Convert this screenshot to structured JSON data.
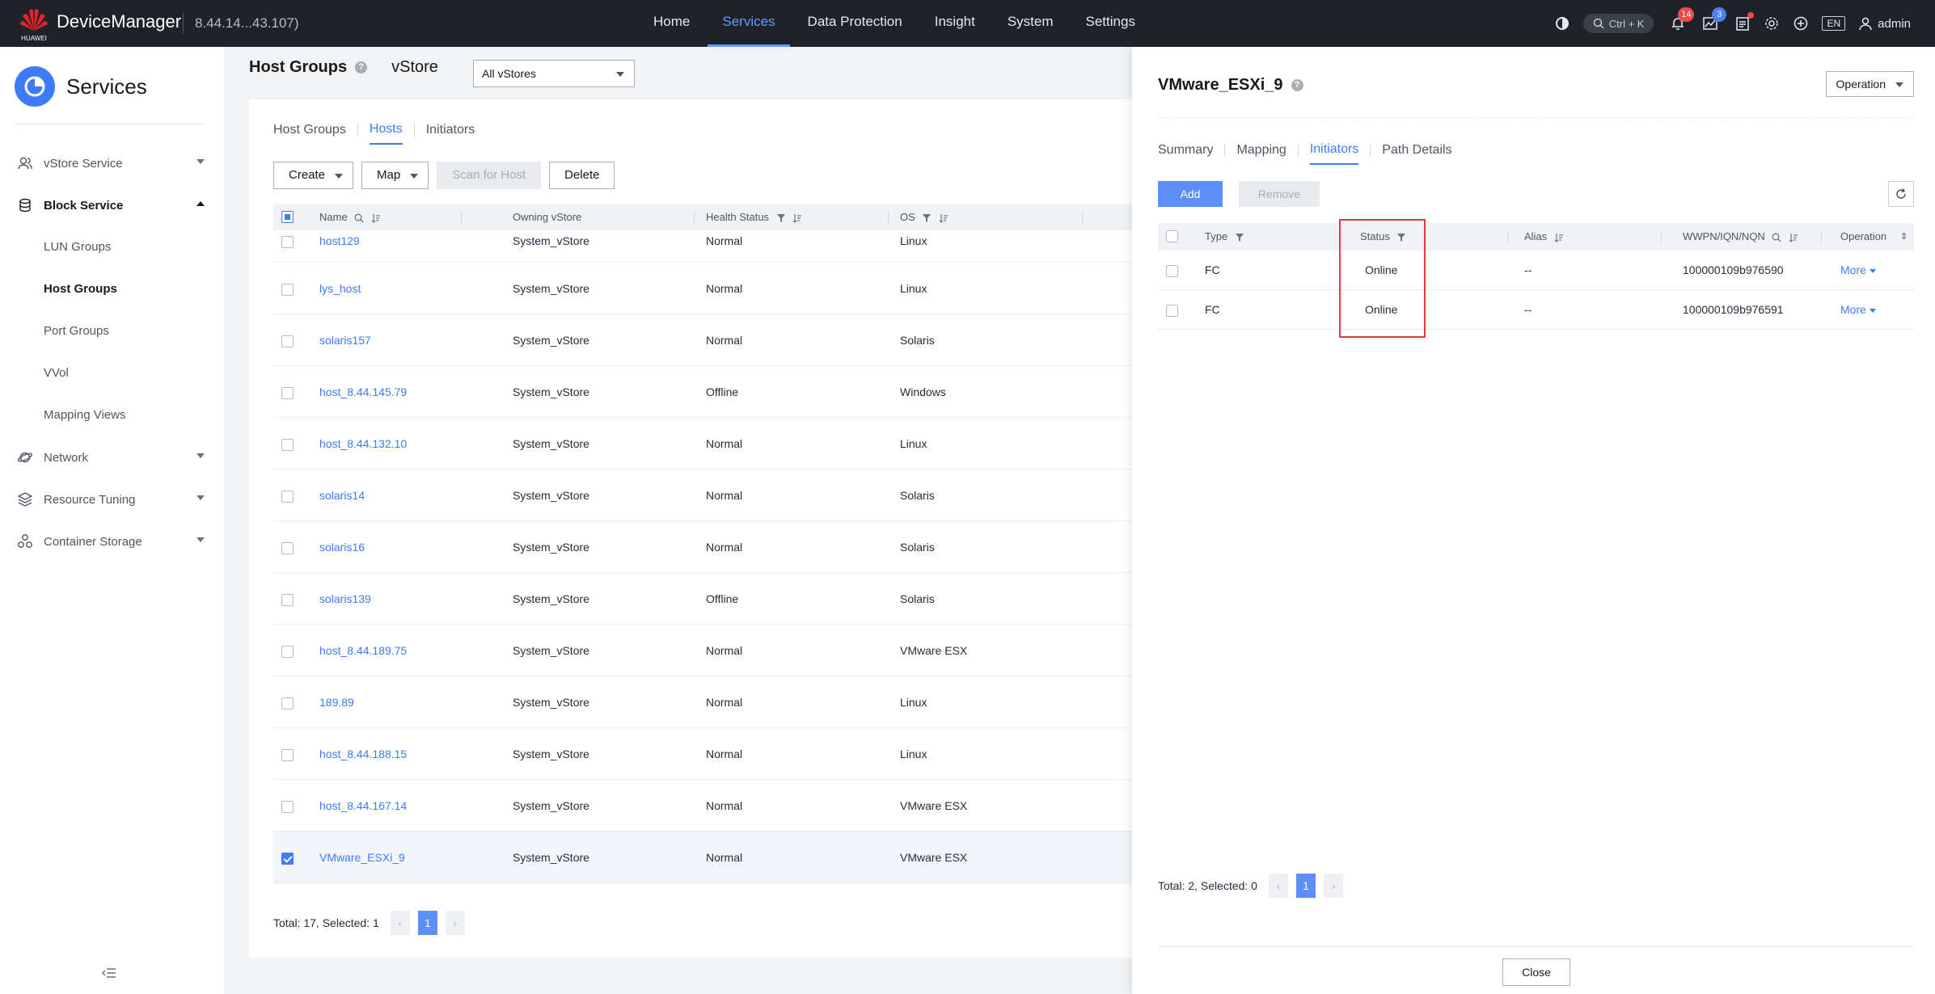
{
  "topbar": {
    "logo_text": "HUAWEI",
    "brand": "DeviceManager",
    "ip": "8.44.14...43.107)",
    "nav": [
      {
        "label": "Home"
      },
      {
        "label": "Services"
      },
      {
        "label": "Data Protection"
      },
      {
        "label": "Insight"
      },
      {
        "label": "System"
      },
      {
        "label": "Settings"
      }
    ],
    "search_hint": "Ctrl + K",
    "alerts_count": "14",
    "tasks_count": "3",
    "lang": "EN",
    "user": "admin"
  },
  "sidebar": {
    "title": "Services",
    "items": [
      {
        "label": "vStore Service"
      },
      {
        "label": "Block Service"
      },
      {
        "label": "Network"
      },
      {
        "label": "Resource Tuning"
      },
      {
        "label": "Container Storage"
      }
    ],
    "block_sub": [
      {
        "label": "LUN Groups"
      },
      {
        "label": "Host Groups"
      },
      {
        "label": "Port Groups"
      },
      {
        "label": "VVol"
      },
      {
        "label": "Mapping Views"
      }
    ]
  },
  "main": {
    "title": "Host Groups",
    "vstore_label": "vStore",
    "vstore_select": "All vStores",
    "tabs": [
      {
        "label": "Host Groups"
      },
      {
        "label": "Hosts"
      },
      {
        "label": "Initiators"
      }
    ],
    "toolbar": {
      "create": "Create",
      "map": "Map",
      "scan": "Scan for Host",
      "delete": "Delete"
    },
    "columns": {
      "name": "Name",
      "vstore": "Owning vStore",
      "health": "Health Status",
      "os": "OS"
    },
    "rows": [
      {
        "name": "host129",
        "vstore": "System_vStore",
        "health": "Normal",
        "os": "Linux"
      },
      {
        "name": "lys_host",
        "vstore": "System_vStore",
        "health": "Normal",
        "os": "Linux"
      },
      {
        "name": "solaris157",
        "vstore": "System_vStore",
        "health": "Normal",
        "os": "Solaris"
      },
      {
        "name": "host_8.44.145.79",
        "vstore": "System_vStore",
        "health": "Offline",
        "os": "Windows"
      },
      {
        "name": "host_8.44.132.10",
        "vstore": "System_vStore",
        "health": "Normal",
        "os": "Linux"
      },
      {
        "name": "solaris14",
        "vstore": "System_vStore",
        "health": "Normal",
        "os": "Solaris"
      },
      {
        "name": "solaris16",
        "vstore": "System_vStore",
        "health": "Normal",
        "os": "Solaris"
      },
      {
        "name": "solaris139",
        "vstore": "System_vStore",
        "health": "Offline",
        "os": "Solaris"
      },
      {
        "name": "host_8.44.189.75",
        "vstore": "System_vStore",
        "health": "Normal",
        "os": "VMware ESX"
      },
      {
        "name": "189.89",
        "vstore": "System_vStore",
        "health": "Normal",
        "os": "Linux"
      },
      {
        "name": "host_8.44.188.15",
        "vstore": "System_vStore",
        "health": "Normal",
        "os": "Linux"
      },
      {
        "name": "host_8.44.167.14",
        "vstore": "System_vStore",
        "health": "Normal",
        "os": "VMware ESX"
      },
      {
        "name": "VMware_ESXi_9",
        "vstore": "System_vStore",
        "health": "Normal",
        "os": "VMware ESX"
      }
    ],
    "pager": {
      "summary": "Total: 17, Selected: 1",
      "page": "1",
      "prev": "‹",
      "next": "›"
    }
  },
  "drawer": {
    "title": "VMware_ESXi_9",
    "operation": "Operation",
    "tabs": [
      {
        "label": "Summary"
      },
      {
        "label": "Mapping"
      },
      {
        "label": "Initiators"
      },
      {
        "label": "Path Details"
      }
    ],
    "add": "Add",
    "remove": "Remove",
    "columns": {
      "type": "Type",
      "status": "Status",
      "alias": "Alias",
      "wwpn": "WWPN/IQN/NQN",
      "operation": "Operation"
    },
    "rows": [
      {
        "type": "FC",
        "status": "Online",
        "alias": "--",
        "wwpn": "100000109b976590",
        "more": "More"
      },
      {
        "type": "FC",
        "status": "Online",
        "alias": "--",
        "wwpn": "100000109b976591",
        "more": "More"
      }
    ],
    "pager": {
      "summary": "Total: 2, Selected: 0",
      "page": "1",
      "prev": "‹",
      "next": "›"
    },
    "close": "Close"
  },
  "colors": {
    "accent": "#3e7bfa",
    "topbar": "#1f2228",
    "highlight": "#e0393e"
  }
}
